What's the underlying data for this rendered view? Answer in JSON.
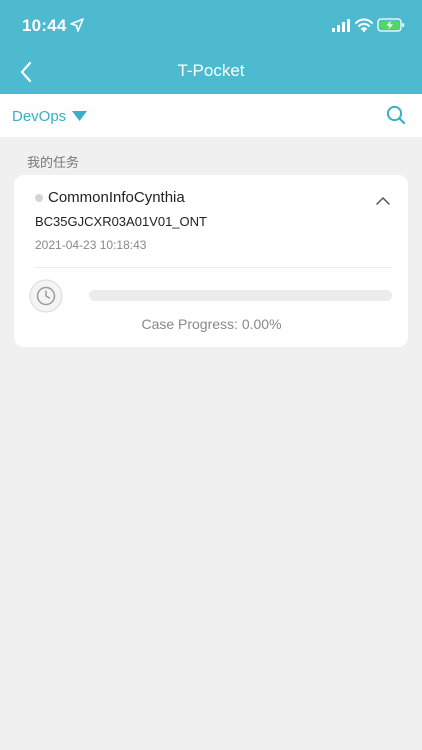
{
  "status_bar": {
    "time": "10:44",
    "icons": [
      "location-arrow-icon",
      "cellular-signal-icon",
      "wifi-icon",
      "battery-charging-icon"
    ]
  },
  "header": {
    "title": "T-Pocket",
    "back_icon": "chevron-left-icon"
  },
  "filter": {
    "project": "DevOps",
    "dropdown_icon": "triangle-down-icon",
    "search_icon": "search-icon"
  },
  "section": {
    "title": "我的任务"
  },
  "tasks": [
    {
      "name": "CommonInfoCynthia",
      "device_id": "BC35GJCXR03A01V01_ONT",
      "timestamp": "2021-04-23 10:18:43",
      "progress": 0,
      "progress_text": "Case Progress: 0.00%",
      "collapse_icon": "chevron-up-icon",
      "status_icon": "clock-icon"
    }
  ],
  "colors": {
    "header_bg": "#4dbad0",
    "accent": "#3aaec6",
    "page_bg": "#f0f0f0",
    "card_bg": "#ffffff",
    "progress_track": "#ececec"
  }
}
